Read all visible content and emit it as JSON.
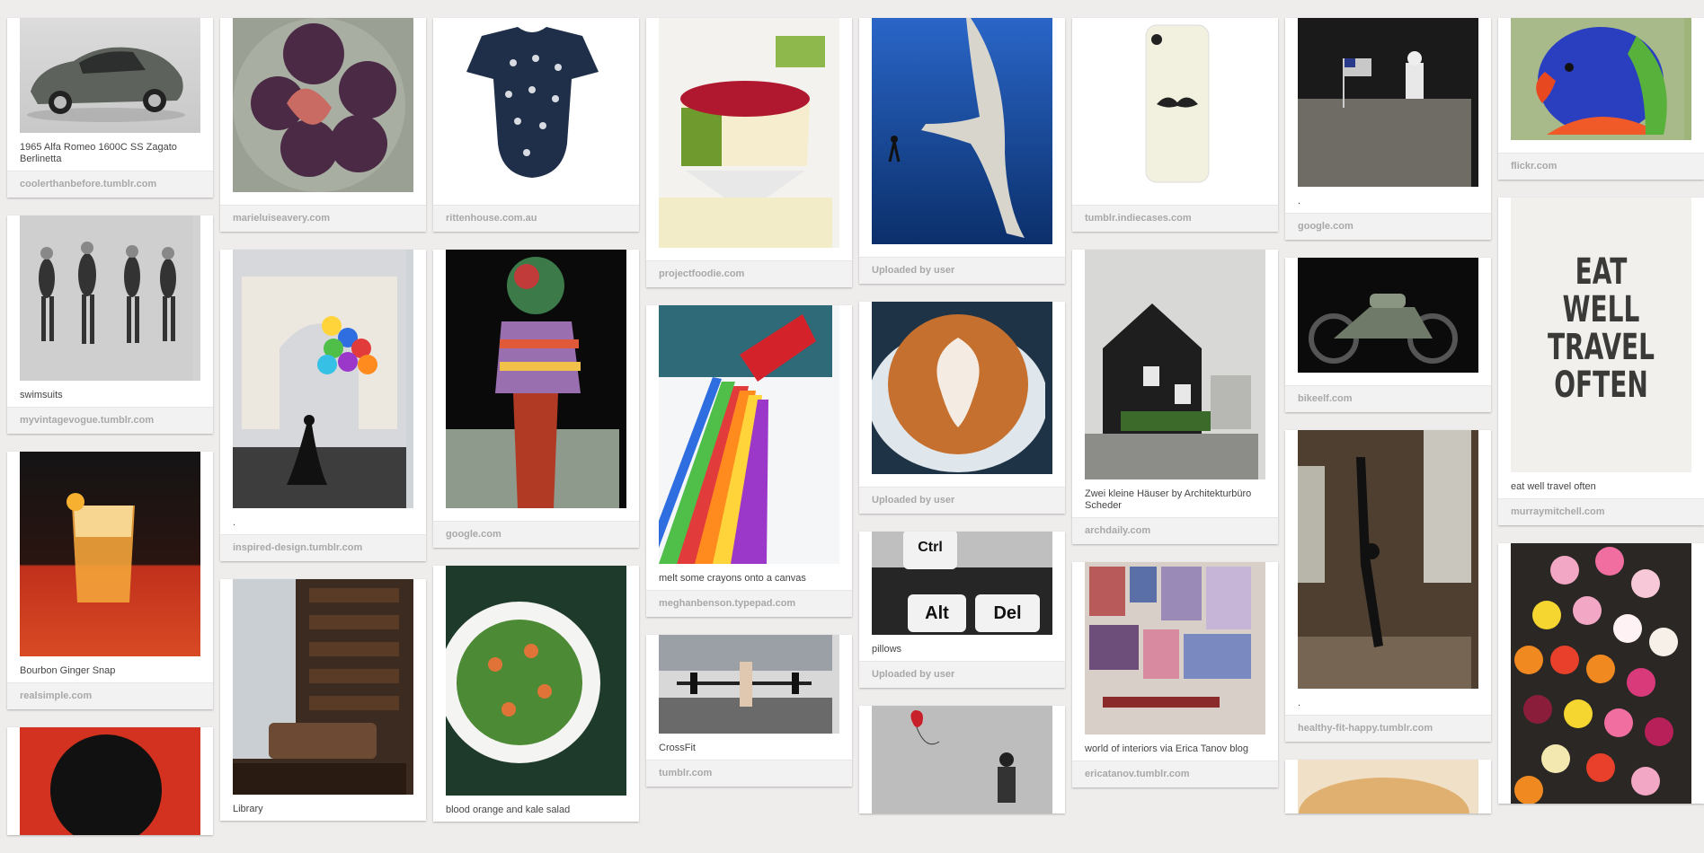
{
  "pins": {
    "c1": [
      {
        "description": "1965 Alfa Romeo 1600C SS Zagato Berlinetta",
        "source": "coolerthanbefore.tumblr.com"
      },
      {
        "description": "swimsuits",
        "source": "myvintagevogue.tumblr.com"
      },
      {
        "description": "Bourbon Ginger Snap",
        "source": "realsimple.com"
      },
      {
        "description": "",
        "source": ""
      }
    ],
    "c2": [
      {
        "description": "",
        "source": "marieluiseavery.com"
      },
      {
        "description": ".",
        "source": "inspired-design.tumblr.com"
      },
      {
        "description": "Library",
        "source": ""
      }
    ],
    "c3": [
      {
        "description": "",
        "source": "rittenhouse.com.au"
      },
      {
        "description": "",
        "source": "google.com"
      },
      {
        "description": "blood orange and kale salad",
        "source": ""
      }
    ],
    "c4": [
      {
        "description": "",
        "source": "projectfoodie.com"
      },
      {
        "description": "melt some crayons onto a canvas",
        "source": "meghanbenson.typepad.com"
      },
      {
        "description": "CrossFit",
        "source": "tumblr.com"
      }
    ],
    "c5": [
      {
        "description": "",
        "source": "Uploaded by user"
      },
      {
        "description": "",
        "source": "Uploaded by user"
      },
      {
        "description": "pillows",
        "source": "Uploaded by user"
      },
      {
        "description": "",
        "source": ""
      }
    ],
    "c6": [
      {
        "description": "",
        "source": "tumblr.indiecases.com"
      },
      {
        "description": "Zwei kleine Häuser by Architekturbüro Scheder",
        "source": "archdaily.com"
      },
      {
        "description": "world of interiors via Erica Tanov blog",
        "source": "ericatanov.tumblr.com"
      }
    ],
    "c7": [
      {
        "description": ".",
        "source": "google.com"
      },
      {
        "description": "",
        "source": "bikeelf.com"
      },
      {
        "description": ".",
        "source": "healthy-fit-happy.tumblr.com"
      },
      {
        "description": "",
        "source": ""
      }
    ],
    "c8": [
      {
        "description": "",
        "source": "flickr.com"
      },
      {
        "description": "eat well travel often",
        "source": "murraymitchell.com"
      },
      {
        "description": "",
        "source": ""
      }
    ]
  },
  "poster": {
    "line1": "EAT",
    "line2": "WELL",
    "line3": "TRAVEL",
    "line4": "OFTEN"
  },
  "pillow_keys": {
    "k1": "Ctrl",
    "k2": "Alt",
    "k3": "Del"
  }
}
